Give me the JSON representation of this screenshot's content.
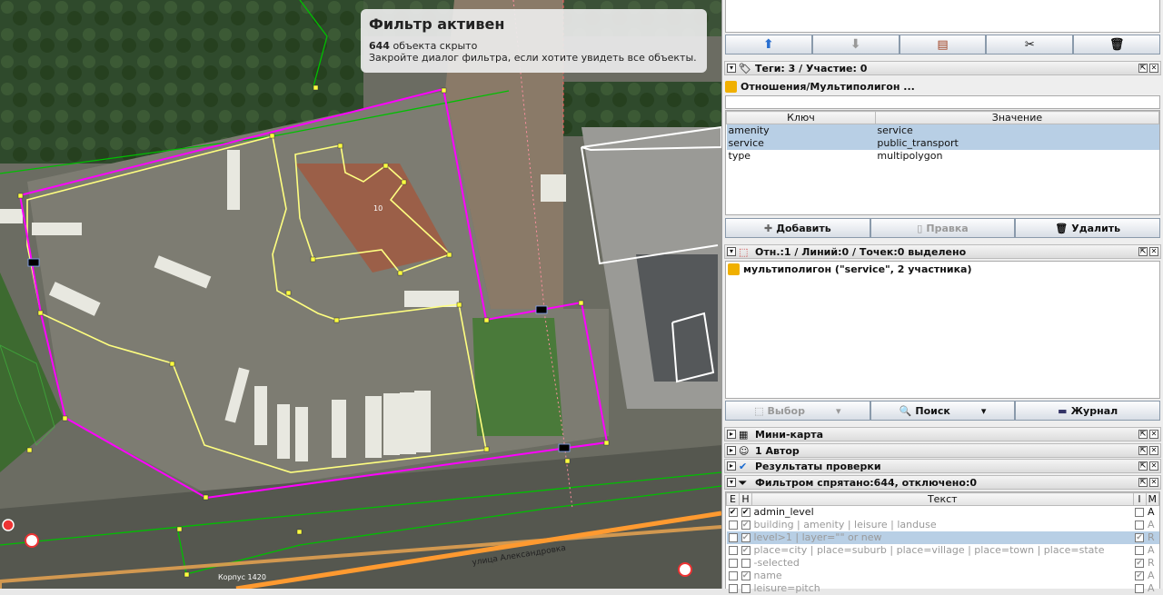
{
  "filter_notice": {
    "title": "Фильтр активен",
    "hidden_count": "644",
    "hidden_text": "объекта скрыто",
    "hint": "Закройте диалог фильтра, если хотите увидеть все объекты."
  },
  "map": {
    "labels": {
      "building_number": "10",
      "street": "улица Александровка",
      "building": "Корпус 1420"
    }
  },
  "relation_toolbar": {
    "icons": [
      "move-up-icon",
      "move-down-icon",
      "edit-relation-icon",
      "split-icon",
      "delete-icon"
    ]
  },
  "tags_panel": {
    "title": "Теги: 3 / Участие: 0",
    "relation_title": "Отношения/Мультиполигон ...",
    "columns": [
      "Ключ",
      "Значение"
    ],
    "rows": [
      {
        "key": "amenity",
        "value": "service"
      },
      {
        "key": "service",
        "value": "public_transport"
      },
      {
        "key": "type",
        "value": "multipolygon"
      }
    ],
    "buttons": {
      "add": "Добавить",
      "edit": "Правка",
      "delete": "Удалить"
    }
  },
  "selection_panel": {
    "title": "Отн.:1 / Линий:0 / Точек:0 выделено",
    "item": "мультиполигон (\"service\", 2 участника)",
    "buttons": {
      "select": "Выбор",
      "search": "Поиск",
      "history": "Журнал"
    }
  },
  "collapsed_panels": {
    "minimap": "Мини-карта",
    "authors": "1 Автор",
    "validation": "Результаты проверки"
  },
  "filter_panel": {
    "title": "Фильтром спрятано:644, отключено:0",
    "columns": [
      "E",
      "H",
      "Текст",
      "I",
      "M"
    ],
    "rows": [
      {
        "e": "✔",
        "h": "✔",
        "text": "admin_level",
        "i": "",
        "m": "A",
        "gray": false,
        "selected": false
      },
      {
        "e": "",
        "h": "✔",
        "text": "building | amenity | leisure | landuse",
        "i": "",
        "m": "A",
        "gray": true,
        "selected": false
      },
      {
        "e": "",
        "h": "✔",
        "text": "level>1 | layer=\"\" or new",
        "i": "✔",
        "m": "R",
        "gray": true,
        "selected": true
      },
      {
        "e": "",
        "h": "✔",
        "text": "place=city | place=suburb | place=village | place=town | place=state",
        "i": "",
        "m": "A",
        "gray": true,
        "selected": false
      },
      {
        "e": "",
        "h": "",
        "text": "-selected",
        "i": "✔",
        "m": "R",
        "gray": true,
        "selected": false
      },
      {
        "e": "",
        "h": "✔",
        "text": "name",
        "i": "✔",
        "m": "A",
        "gray": true,
        "selected": false
      },
      {
        "e": "",
        "h": "",
        "text": "leisure=pitch",
        "i": "",
        "m": "A",
        "gray": true,
        "selected": false
      }
    ]
  },
  "colors": {
    "relation": "#ff00ff",
    "way": "#ffff80",
    "road": "#00c000",
    "selected_row": "#b8cfe5"
  }
}
